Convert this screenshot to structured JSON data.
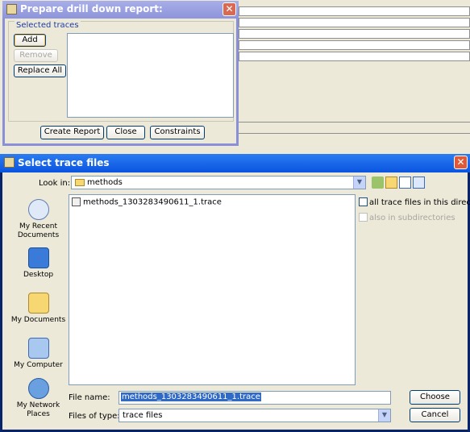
{
  "drill_dialog": {
    "title": "Prepare drill down report:",
    "group_label": "Selected traces",
    "add_label": "Add",
    "remove_label": "Remove",
    "replace_all_label": "Replace All",
    "create_report_label": "Create Report",
    "close_label": "Close",
    "constraints_label": "Constraints"
  },
  "file_dialog": {
    "title": "Select trace files",
    "look_in_label": "Look in:",
    "look_in_value": "methods",
    "sidebar": [
      {
        "label": "My Recent Documents",
        "icon": "recent-documents-icon"
      },
      {
        "label": "Desktop",
        "icon": "desktop-icon"
      },
      {
        "label": "My Documents",
        "icon": "my-documents-icon"
      },
      {
        "label": "My Computer",
        "icon": "my-computer-icon"
      },
      {
        "label": "My Network Places",
        "icon": "network-places-icon"
      }
    ],
    "files": [
      "methods_1303283490611_1.trace"
    ],
    "all_in_dir_label": "all trace files in this directory",
    "subdirs_label": "also in subdirectories",
    "file_name_label": "File name:",
    "file_name_value": "methods_1303283490611_1.trace",
    "files_of_type_label": "Files of type:",
    "files_of_type_value": "trace files",
    "choose_label": "Choose",
    "cancel_label": "Cancel"
  }
}
